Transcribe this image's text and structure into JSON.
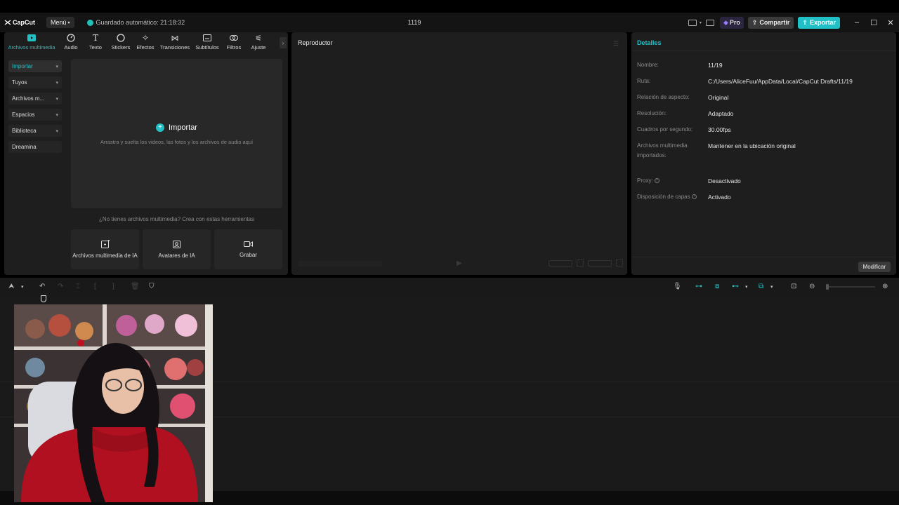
{
  "app": {
    "brand": "CapCut",
    "menu_label": "Menú",
    "autosave": "Guardado automático: 21:18:32",
    "project_title": "1119",
    "pro_label": "Pro",
    "share_label": "Compartir",
    "export_label": "Exportar",
    "accent": "#23c1c6"
  },
  "tools": [
    {
      "label": "Archivos multimedia",
      "icon": "media-icon",
      "active": true
    },
    {
      "label": "Audio",
      "icon": "audio-icon"
    },
    {
      "label": "Texto",
      "icon": "text-icon"
    },
    {
      "label": "Stickers",
      "icon": "sticker-icon"
    },
    {
      "label": "Efectos",
      "icon": "effects-icon"
    },
    {
      "label": "Transiciones",
      "icon": "transitions-icon"
    },
    {
      "label": "Subtítulos",
      "icon": "subtitles-icon"
    },
    {
      "label": "Filtros",
      "icon": "filters-icon"
    },
    {
      "label": "Ajuste",
      "icon": "adjust-icon"
    }
  ],
  "sidebar": {
    "items": [
      {
        "label": "Importar",
        "active": true,
        "chevron": true
      },
      {
        "label": "Tuyos",
        "chevron": true
      },
      {
        "label": "Archivos m...",
        "chevron": true
      },
      {
        "label": "Espacios",
        "chevron": true
      },
      {
        "label": "Biblioteca",
        "chevron": true
      },
      {
        "label": "Dreamina",
        "chevron": false
      }
    ]
  },
  "import": {
    "title": "Importar",
    "subtitle": "Arrastra y suelta los videos, las fotos y los archivos de audio aquí",
    "no_media": "¿No tienes archivos multimedia? Crea con estas herramientas",
    "cards": [
      {
        "label": "Archivos multimedia de IA",
        "icon": "ai-media-icon"
      },
      {
        "label": "Avatares de IA",
        "icon": "ai-avatar-icon"
      },
      {
        "label": "Grabar",
        "icon": "record-icon"
      }
    ]
  },
  "player": {
    "title": "Reproductor"
  },
  "details": {
    "title": "Detalles",
    "rows": [
      {
        "key": "Nombre:",
        "value": "11/19"
      },
      {
        "key": "Ruta:",
        "value": "C:/Users/AliceFuu/AppData/Local/CapCut Drafts/11/19"
      },
      {
        "key": "Relación de aspecto:",
        "value": "Original"
      },
      {
        "key": "Resolución:",
        "value": "Adaptado"
      },
      {
        "key": "Cuadros por segundo:",
        "value": "30.00fps"
      },
      {
        "key": "Archivos multimedia importados:",
        "value": "Mantener en la ubicación original"
      },
      {
        "key": "Proxy:",
        "value": "Desactivado",
        "help": true
      },
      {
        "key": "Disposición de capas",
        "value": "Activado",
        "help": true
      }
    ],
    "modify_label": "Modificar"
  }
}
